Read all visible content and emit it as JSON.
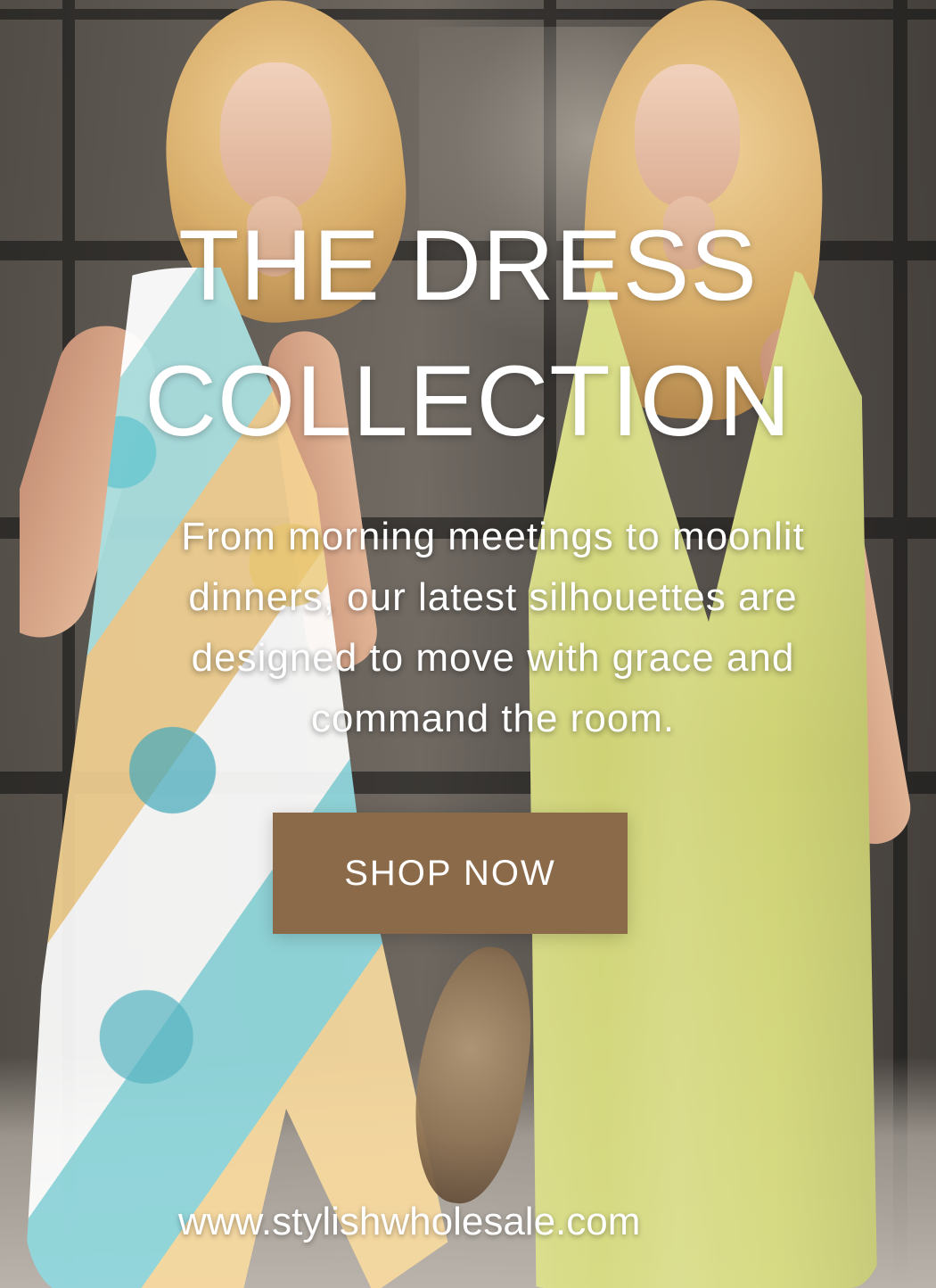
{
  "hero": {
    "headline": "THE DRESS COLLECTION",
    "subtitle": "From morning meetings to moonlit dinners, our latest silhouettes are designed to move with grace and command the room.",
    "cta_label": "SHOP NOW",
    "website": "www.stylishwholesale.com"
  },
  "colors": {
    "text": "#ffffff",
    "button_background": "#8b6a49"
  }
}
